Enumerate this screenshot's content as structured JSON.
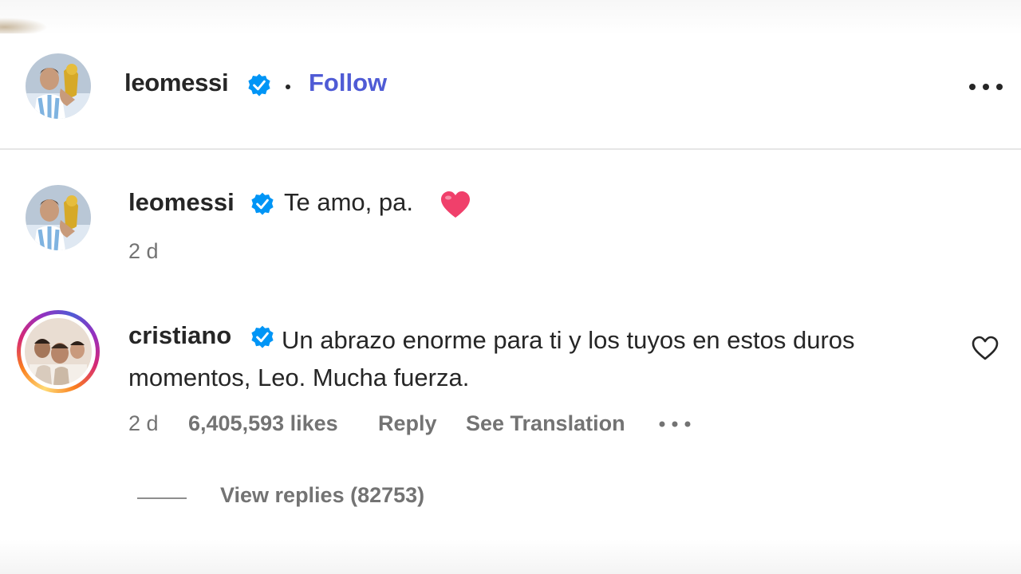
{
  "header": {
    "username": "leomessi",
    "separator": "•",
    "follow_label": "Follow",
    "more_icon": "more-horizontal-icon"
  },
  "caption": {
    "username": "leomessi",
    "text": "Te amo, pa.",
    "emoji_icon": "red-heart-icon",
    "time": "2 d"
  },
  "comment": {
    "username": "cristiano",
    "text": "Un abrazo enorme para ti y los tuyos en estos duros momentos, Leo. Mucha fuerza.",
    "time": "2 d",
    "likes": "6,405,593 likes",
    "reply_label": "Reply",
    "translate_label": "See Translation",
    "like_icon": "heart-outline-icon",
    "view_replies_label": "View replies (82753)"
  },
  "colors": {
    "text": "#262626",
    "secondary": "#737373",
    "follow": "#4f5bd5",
    "verified": "#0095f6",
    "heart": "#f0406b"
  }
}
